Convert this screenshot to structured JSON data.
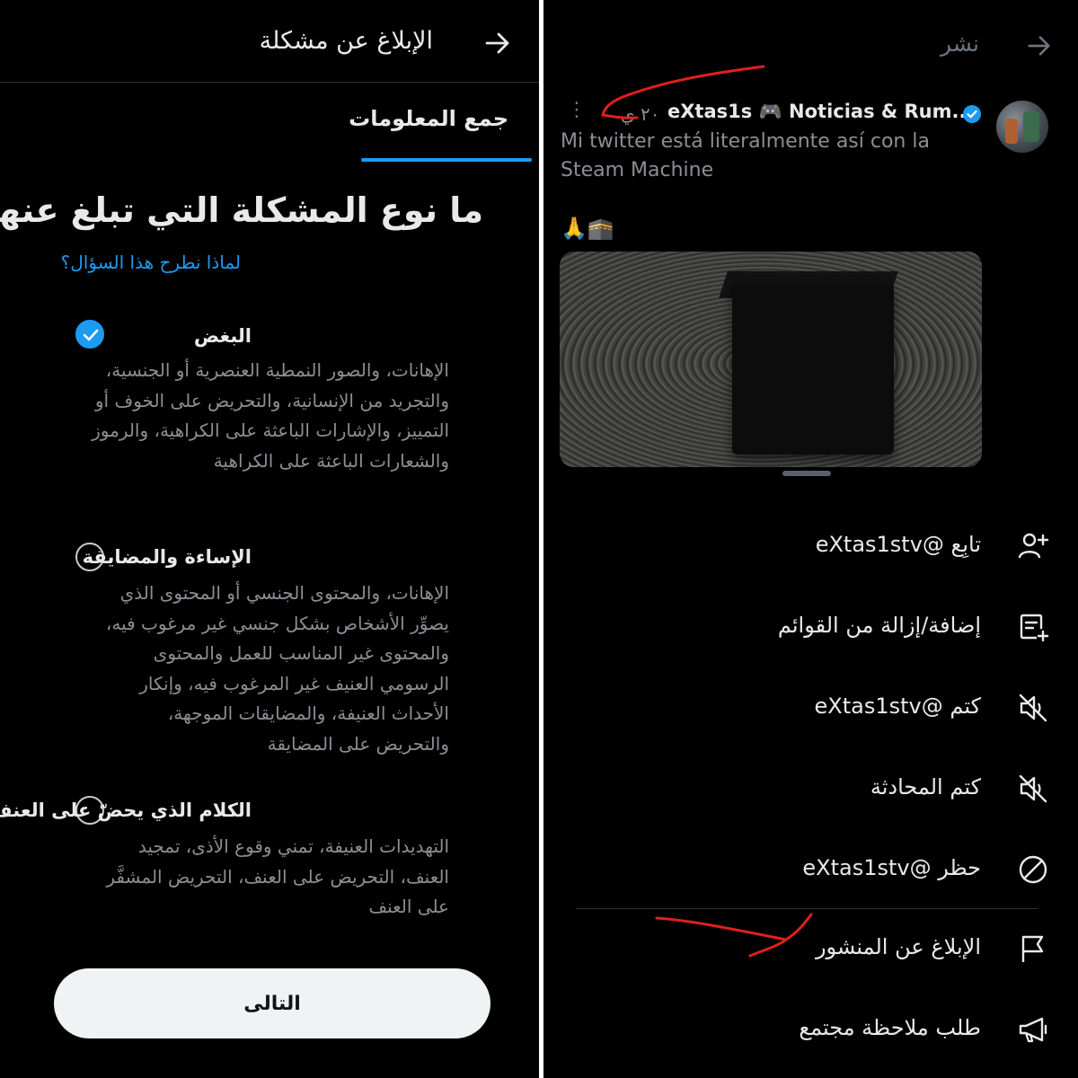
{
  "left": {
    "header_title": "الإبلاغ عن مشكلة",
    "tab_label": "جمع المعلومات",
    "question": "ما نوع المشكلة التي تبلغ عنها؟",
    "why_link": "لماذا نطرح هذا السؤال؟",
    "options": [
      {
        "title": "البغض",
        "description": "الإهانات، والصور النمطية العنصرية أو الجنسية، والتجريد من الإنسانية، والتحريض على الخوف أو التمييز، والإشارات الباعثة على الكراهية، والرموز والشعارات الباعثة على الكراهية",
        "selected": true
      },
      {
        "title": "الإساءة والمضايقة",
        "description": "الإهانات، والمحتوى الجنسي أو المحتوى الذي يصوِّر الأشخاص بشكل جنسي غير مرغوب فيه، والمحتوى غير المناسب للعمل والمحتوى الرسومي العنيف غير المرغوب فيه، وإنكار الأحداث العنيفة، والمضايقات الموجهة، والتحريض على المضايقة",
        "selected": false
      },
      {
        "title": "الكلام الذي يحضّ على العنف",
        "description": "التهديدات العنيفة، تمني وقوع الأذى، تمجيد العنف، التحريض على العنف، التحريض المشفَّر على العنف",
        "selected": false
      }
    ],
    "next_button": "التالى"
  },
  "right": {
    "header_title": "نشر",
    "tweet": {
      "author_name": "eXtas1s 🎮 Noticias & Rum...",
      "time": "٢٠ ي",
      "text": "Mi twitter está literalmente así con la\nSteam Machine",
      "emoji": "🙏🕋"
    },
    "menu": [
      {
        "label": "تابِع @eXtas1stv",
        "icon": "follow-user-icon"
      },
      {
        "label": "إضافة/إزالة من القوائم",
        "icon": "list-add-icon"
      },
      {
        "label": "كتم @eXtas1stv",
        "icon": "mute-icon"
      },
      {
        "label": "كتم المحادثة",
        "icon": "mute-icon"
      },
      {
        "label": "حظر @eXtas1stv",
        "icon": "block-icon"
      },
      {
        "label": "الإبلاغ عن المنشور",
        "icon": "flag-icon"
      },
      {
        "label": "طلب ملاحظة مجتمع",
        "icon": "megaphone-icon"
      }
    ]
  },
  "colors": {
    "background": "#000000",
    "accent": "#1d9bf0",
    "text_primary": "#e7e9ea",
    "text_secondary": "#8b8f94",
    "annotation": "#e0201b"
  }
}
